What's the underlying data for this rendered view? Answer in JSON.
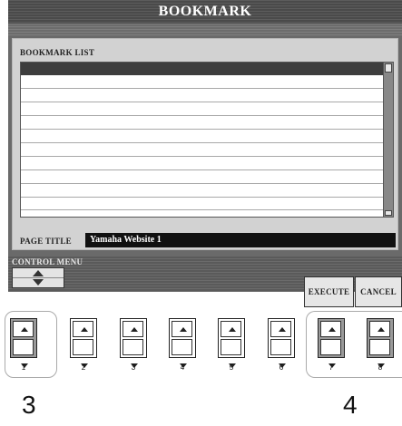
{
  "title": "BOOKMARK",
  "bookmark_list": {
    "label": "BOOKMARK LIST",
    "selected_index": 0,
    "row_count": 11
  },
  "page_title": {
    "label": "PAGE TITLE",
    "value": "Yamaha Website 1"
  },
  "control_menu": {
    "label": "CONTROL MENU"
  },
  "buttons": {
    "execute": "EXECUTE",
    "cancel": "CANCEL"
  },
  "hardware_buttons": [
    "1",
    "2",
    "3",
    "4",
    "5",
    "6",
    "7",
    "8"
  ],
  "callouts": {
    "left": "3",
    "right": "4"
  },
  "colors": {
    "screen_bg": "#6a6a6a",
    "panel_bg": "#d2d2d2",
    "selected_row": "#3d3d3d",
    "field_bg": "#111111"
  }
}
